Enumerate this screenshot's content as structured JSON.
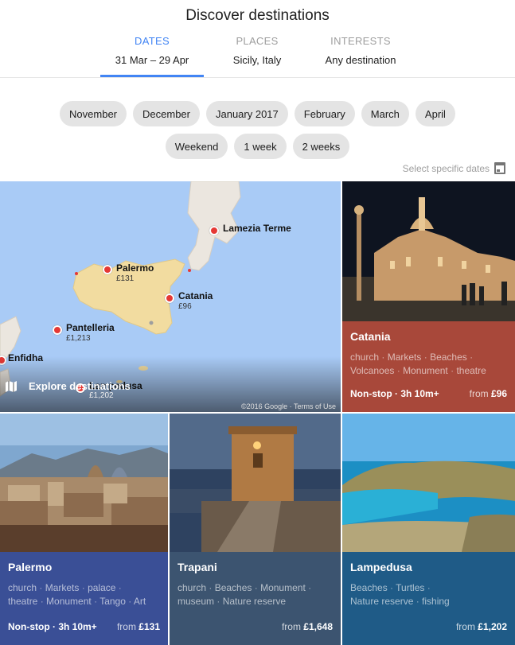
{
  "header": {
    "title": "Discover destinations",
    "tabs": [
      {
        "label": "DATES",
        "value": "31 Mar – 29 Apr"
      },
      {
        "label": "PLACES",
        "value": "Sicily, Italy"
      },
      {
        "label": "INTERESTS",
        "value": "Any destination"
      }
    ]
  },
  "chips": {
    "row1": [
      "November",
      "December",
      "January 2017",
      "February",
      "March",
      "April"
    ],
    "row2": [
      "Weekend",
      "1 week",
      "2 weeks"
    ]
  },
  "specific_dates": {
    "label": "Select specific dates",
    "icon": "calendar-icon"
  },
  "map": {
    "pins": [
      {
        "name": "Lamezia Terme",
        "price": ""
      },
      {
        "name": "Palermo",
        "price": "£131"
      },
      {
        "name": "Catania",
        "price": "£96"
      },
      {
        "name": "Pantelleria",
        "price": "£1,213"
      },
      {
        "name": "Enfidha",
        "price": ""
      },
      {
        "name": "Lampedusa",
        "price": "£1,202"
      }
    ],
    "explore_label": "Explore destinations",
    "attribution": "©2016 Google · Terms of Use",
    "colors": {
      "sea": "#a9cbf6",
      "land": "#f2dca0",
      "italy": "#ebe6df"
    }
  },
  "cards": [
    {
      "name": "Catania",
      "tags": [
        "church",
        "Markets",
        "Beaches",
        "Volcanoes",
        "Monument",
        "theatre"
      ],
      "stop": "Non-stop · 3h 10m+",
      "from_prefix": "from",
      "price": "£96",
      "color": "#a8483a"
    },
    {
      "name": "Palermo",
      "tags": [
        "church",
        "Markets",
        "palace",
        "theatre",
        "Monument",
        "Tango",
        "Art"
      ],
      "stop": "Non-stop · 3h 10m+",
      "from_prefix": "from",
      "price": "£131",
      "color": "#3a4f96"
    },
    {
      "name": "Trapani",
      "tags": [
        "church",
        "Beaches",
        "Monument",
        "museum",
        "Nature reserve"
      ],
      "stop": "",
      "from_prefix": "from",
      "price": "£1,648",
      "color": "#3c5470"
    },
    {
      "name": "Lampedusa",
      "tags": [
        "Beaches",
        "Turtles",
        "Nature reserve",
        "fishing"
      ],
      "stop": "",
      "from_prefix": "from",
      "price": "£1,202",
      "color": "#1f5b87"
    }
  ]
}
